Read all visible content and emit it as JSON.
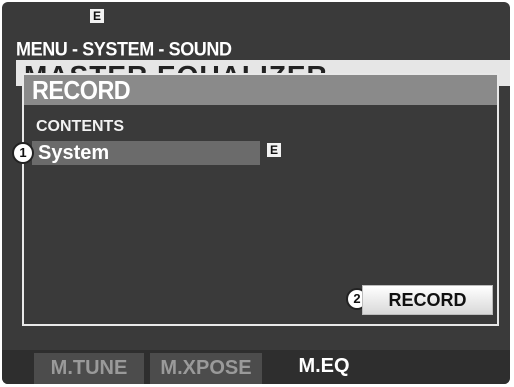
{
  "status": {
    "edit_badge": "E"
  },
  "header": {
    "breadcrumb": "MENU - SYSTEM - SOUND",
    "page_title": "MASTER EQUALIZER"
  },
  "dialog": {
    "title": "RECORD",
    "contents_label": "CONTENTS",
    "contents_value": "System",
    "contents_badge": "E",
    "record_button": "RECORD"
  },
  "callouts": [
    "1",
    "2"
  ],
  "tabs": [
    {
      "label": "M.TUNE",
      "active": false
    },
    {
      "label": "M.XPOSE",
      "active": false
    },
    {
      "label": "M.EQ",
      "active": true
    }
  ],
  "colors": {
    "screen_bg": "#3a3a3a",
    "dialog_title_bg": "#8a8a8a",
    "selected_row_bg": "#6b6b6b",
    "text": "#ffffff"
  }
}
